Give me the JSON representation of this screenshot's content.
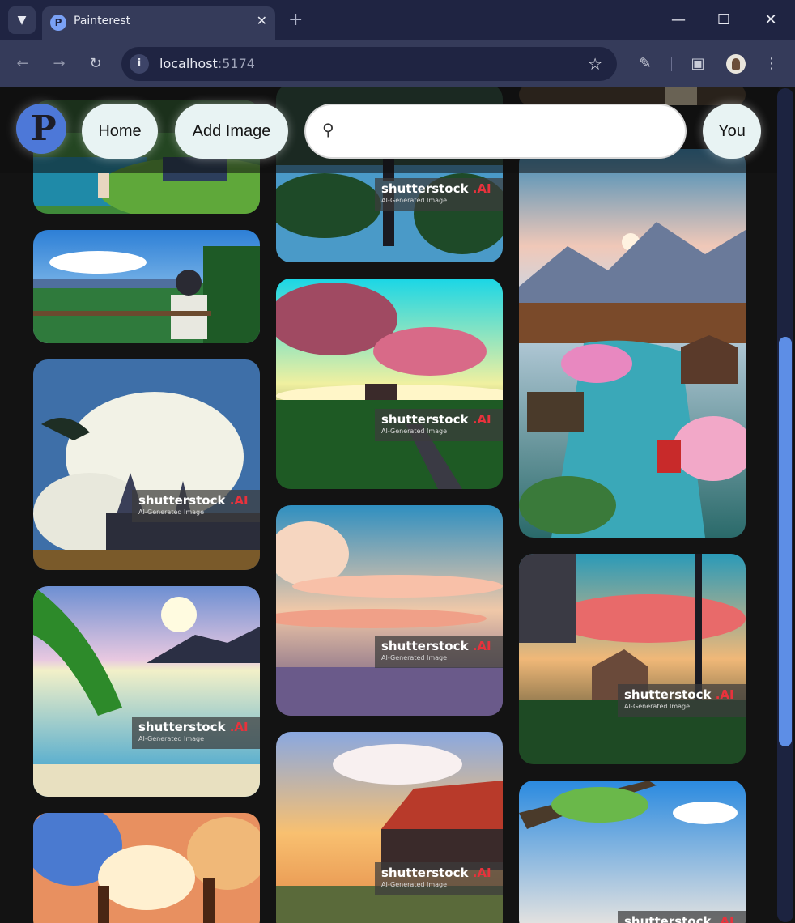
{
  "browser": {
    "tab_title": "Painterest",
    "url_host": "localhost",
    "url_port": ":5174"
  },
  "app": {
    "nav": {
      "home_label": "Home",
      "add_image_label": "Add Image",
      "you_label": "You"
    },
    "search": {
      "placeholder": "",
      "value": ""
    }
  },
  "watermark": {
    "brand": "shutterstock",
    "ai_mark": ".AI",
    "sub": "AI-Generated Image"
  },
  "icons": [
    "tab-list-icon",
    "painterest-favicon",
    "close-tab-icon",
    "new-tab-icon",
    "minimize-icon",
    "maximize-icon",
    "close-window-icon",
    "back-icon",
    "forward-icon",
    "reload-icon",
    "site-info-icon",
    "bookmark-star-icon",
    "extensions-icon",
    "cast-icon",
    "profile-avatar",
    "menu-icon",
    "painterest-logo",
    "search-icon"
  ]
}
